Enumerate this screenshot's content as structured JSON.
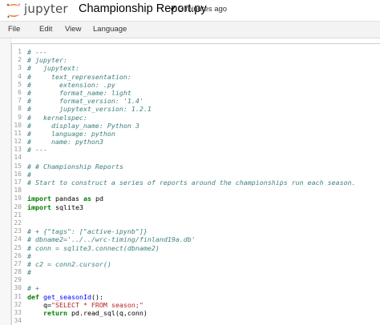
{
  "header": {
    "logo_text": "jupyter",
    "notebook_title": "Championship Report.py",
    "save_status": "3 minutes ago"
  },
  "menu": {
    "items": [
      "File",
      "Edit",
      "View",
      "Language"
    ]
  },
  "code_lines": [
    [
      {
        "t": "# ---",
        "c": "cm"
      }
    ],
    [
      {
        "t": "# jupyter:",
        "c": "cm"
      }
    ],
    [
      {
        "t": "#   jupytext:",
        "c": "cm"
      }
    ],
    [
      {
        "t": "#     text_representation:",
        "c": "cm"
      }
    ],
    [
      {
        "t": "#       extension: .py",
        "c": "cm"
      }
    ],
    [
      {
        "t": "#       format_name: light",
        "c": "cm"
      }
    ],
    [
      {
        "t": "#       format_version: '1.4'",
        "c": "cm"
      }
    ],
    [
      {
        "t": "#       jupytext_version: 1.2.1",
        "c": "cm"
      }
    ],
    [
      {
        "t": "#   kernelspec:",
        "c": "cm"
      }
    ],
    [
      {
        "t": "#     display_name: Python 3",
        "c": "cm"
      }
    ],
    [
      {
        "t": "#     language: python",
        "c": "cm"
      }
    ],
    [
      {
        "t": "#     name: python3",
        "c": "cm"
      }
    ],
    [
      {
        "t": "# ---",
        "c": "cm"
      }
    ],
    [],
    [
      {
        "t": "# # Championship Reports",
        "c": "cm"
      }
    ],
    [
      {
        "t": "#",
        "c": "cm"
      }
    ],
    [
      {
        "t": "# Start to construct a series of reports around the championships run each season.",
        "c": "cm"
      }
    ],
    [],
    [
      {
        "t": "import",
        "c": "kw"
      },
      {
        "t": " pandas ",
        "c": ""
      },
      {
        "t": "as",
        "c": "kw"
      },
      {
        "t": " pd",
        "c": ""
      }
    ],
    [
      {
        "t": "import",
        "c": "kw"
      },
      {
        "t": " sqlite3",
        "c": ""
      }
    ],
    [],
    [],
    [
      {
        "t": "# + {\"tags\": [\"active-ipynb\"]}",
        "c": "cm"
      }
    ],
    [
      {
        "t": "# dbname2='../../wrc-timing/finland19a.db'",
        "c": "cm"
      }
    ],
    [
      {
        "t": "# conn = sqlite3.connect(dbname2)",
        "c": "cm"
      }
    ],
    [
      {
        "t": "#",
        "c": "cm"
      }
    ],
    [
      {
        "t": "# c2 = conn2.cursor()",
        "c": "cm"
      }
    ],
    [
      {
        "t": "#",
        "c": "cm"
      }
    ],
    [],
    [
      {
        "t": "# +",
        "c": "cm"
      }
    ],
    [
      {
        "t": "def",
        "c": "kw"
      },
      {
        "t": " ",
        "c": ""
      },
      {
        "t": "get_seasonId",
        "c": "fn"
      },
      {
        "t": "():",
        "c": ""
      }
    ],
    [
      {
        "t": "    q=",
        "c": ""
      },
      {
        "t": "\"SELECT * FROM season;\"",
        "c": "st"
      }
    ],
    [
      {
        "t": "    ",
        "c": ""
      },
      {
        "t": "return",
        "c": "kw"
      },
      {
        "t": " pd.read_sql(q,conn)",
        "c": ""
      }
    ],
    []
  ]
}
